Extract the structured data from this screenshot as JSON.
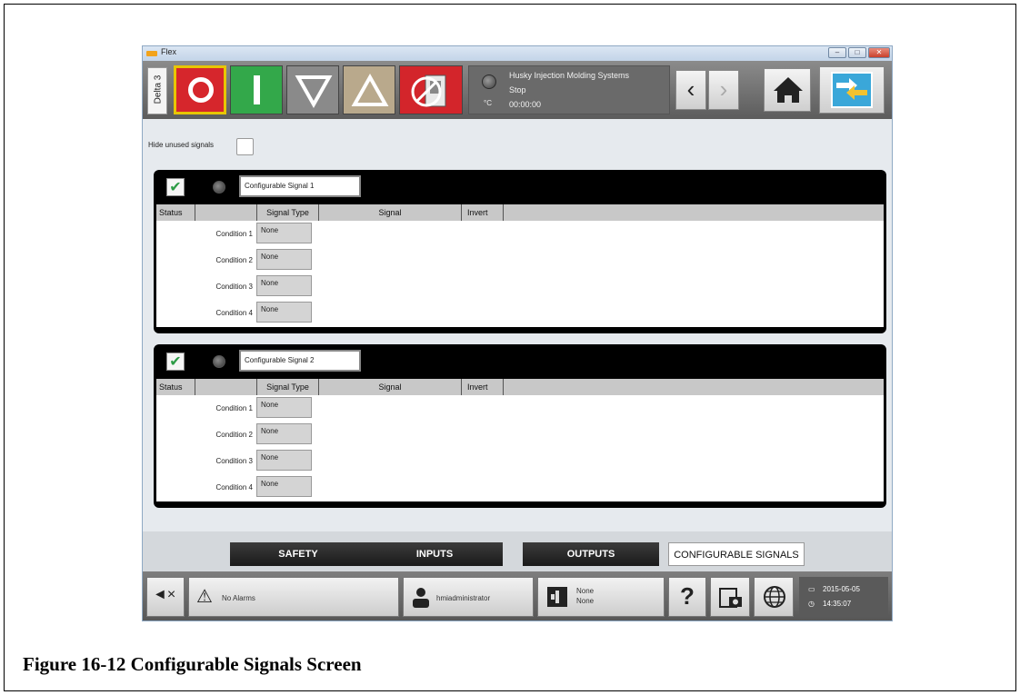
{
  "window": {
    "title": "Flex",
    "controls": {
      "minimize": "–",
      "maximize": "□",
      "close": "✕"
    }
  },
  "toolbar": {
    "machine_tab": "Delta 3",
    "status_lines": [
      "Husky Injection Molding Systems",
      "Stop",
      "00:00:00"
    ],
    "temp_unit": "°C",
    "nav_back": "‹",
    "nav_forward": "›"
  },
  "hide_unused_label": "Hide unused signals",
  "columns": {
    "status": "Status",
    "signal_type": "Signal Type",
    "signal": "Signal",
    "invert": "Invert"
  },
  "panels": [
    {
      "name": "Configurable Signal 1",
      "checked": true,
      "conditions": [
        {
          "label": "Condition 1",
          "type": "None"
        },
        {
          "label": "Condition 2",
          "type": "None"
        },
        {
          "label": "Condition 3",
          "type": "None"
        },
        {
          "label": "Condition 4",
          "type": "None"
        }
      ]
    },
    {
      "name": "Configurable Signal 2",
      "checked": true,
      "conditions": [
        {
          "label": "Condition 1",
          "type": "None"
        },
        {
          "label": "Condition 2",
          "type": "None"
        },
        {
          "label": "Condition 3",
          "type": "None"
        },
        {
          "label": "Condition 4",
          "type": "None"
        }
      ]
    }
  ],
  "tabs": [
    "SAFETY",
    "INPUTS",
    "OUTPUTS",
    "CONFIGURABLE SIGNALS"
  ],
  "active_tab": "CONFIGURABLE SIGNALS",
  "statusbar": {
    "alarms": "No Alarms",
    "user": "hmiadministrator",
    "mold_line1": "None",
    "mold_line2": "None",
    "help": "?",
    "date": "2015-05-05",
    "time": "14:35:07"
  },
  "caption": "Figure 16-12 Configurable Signals Screen",
  "colors": {
    "stop": "#d6262c",
    "start": "#33a84a",
    "accent": "#3aa7d9"
  }
}
